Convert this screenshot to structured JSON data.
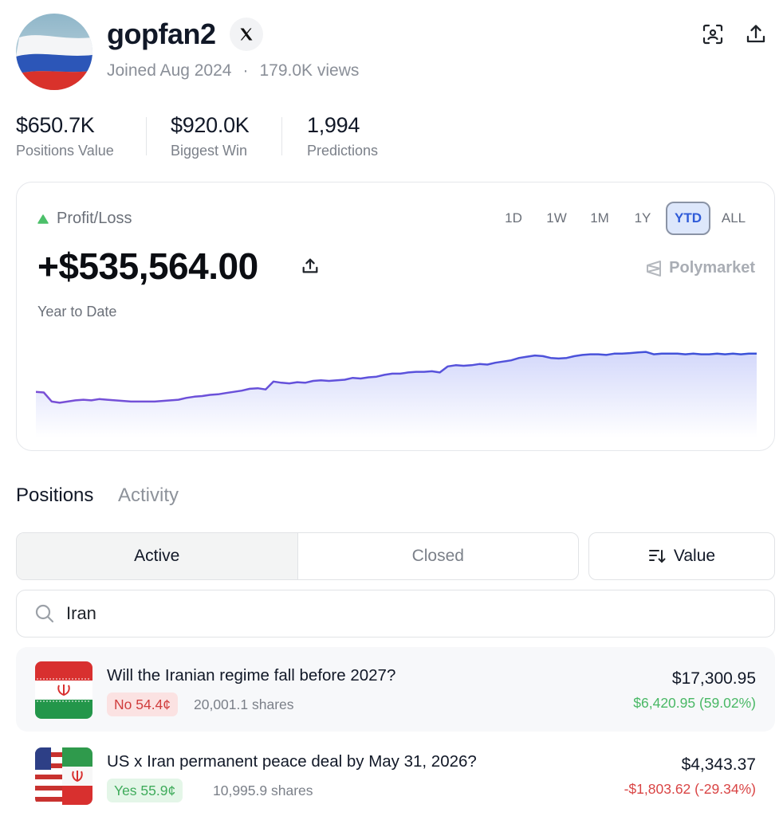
{
  "profile": {
    "username": "gopfan2",
    "joined": "Joined Aug 2024",
    "separator": "·",
    "views": "179.0K views",
    "avatar_icon": "russian-flag-avatar",
    "social_icon": "x-logo-icon"
  },
  "header_actions": {
    "scan_icon": "scan-face-icon",
    "share_icon": "share-icon"
  },
  "stats": [
    {
      "value": "$650.7K",
      "label": "Positions Value"
    },
    {
      "value": "$920.0K",
      "label": "Biggest Win"
    },
    {
      "value": "1,994",
      "label": "Predictions"
    }
  ],
  "pnl": {
    "label": "Profit/Loss",
    "value": "+$535,564.00",
    "period": "Year to Date",
    "brand": "Polymarket",
    "ranges": [
      "1D",
      "1W",
      "1M",
      "1Y",
      "YTD",
      "ALL"
    ],
    "active_range": "YTD",
    "line_color": "#3f51d8",
    "up_color": "#4cc06a"
  },
  "chart_data": {
    "type": "area",
    "title": "",
    "xlabel": "",
    "ylabel": "",
    "note": "relative P/L trajectory; no axis values shown",
    "values": [
      0.28,
      0.27,
      0.12,
      0.1,
      0.12,
      0.14,
      0.15,
      0.14,
      0.16,
      0.15,
      0.14,
      0.13,
      0.12,
      0.12,
      0.12,
      0.12,
      0.13,
      0.14,
      0.15,
      0.18,
      0.2,
      0.21,
      0.23,
      0.24,
      0.26,
      0.28,
      0.3,
      0.33,
      0.34,
      0.32,
      0.45,
      0.43,
      0.42,
      0.44,
      0.43,
      0.46,
      0.47,
      0.46,
      0.47,
      0.48,
      0.51,
      0.5,
      0.52,
      0.53,
      0.56,
      0.58,
      0.58,
      0.6,
      0.61,
      0.61,
      0.62,
      0.6,
      0.7,
      0.72,
      0.71,
      0.72,
      0.74,
      0.73,
      0.76,
      0.78,
      0.8,
      0.84,
      0.86,
      0.88,
      0.87,
      0.84,
      0.83,
      0.84,
      0.87,
      0.89,
      0.9,
      0.9,
      0.89,
      0.91,
      0.91,
      0.92,
      0.93,
      0.94,
      0.9,
      0.91,
      0.91,
      0.91,
      0.9,
      0.91,
      0.9,
      0.9,
      0.91,
      0.9,
      0.91,
      0.9,
      0.91,
      0.91
    ]
  },
  "tabs": {
    "positions": "Positions",
    "activity": "Activity"
  },
  "filters": {
    "active": "Active",
    "closed": "Closed",
    "sort": "Value"
  },
  "search": {
    "value": "Iran",
    "placeholder": "Search"
  },
  "positions": [
    {
      "title": "Will the Iranian regime fall before 2027?",
      "outcome": "No 54.4¢",
      "outcome_type": "no",
      "shares": "20,001.1 shares",
      "value": "$17,300.95",
      "change": "$6,420.95 (59.02%)",
      "change_dir": "up"
    },
    {
      "title": "US x Iran permanent peace deal by May 31, 2026?",
      "outcome": "Yes 55.9¢",
      "outcome_type": "yes",
      "shares": "10,995.9 shares",
      "value": "$4,343.37",
      "change": "-$1,803.62 (-29.34%)",
      "change_dir": "down"
    }
  ]
}
